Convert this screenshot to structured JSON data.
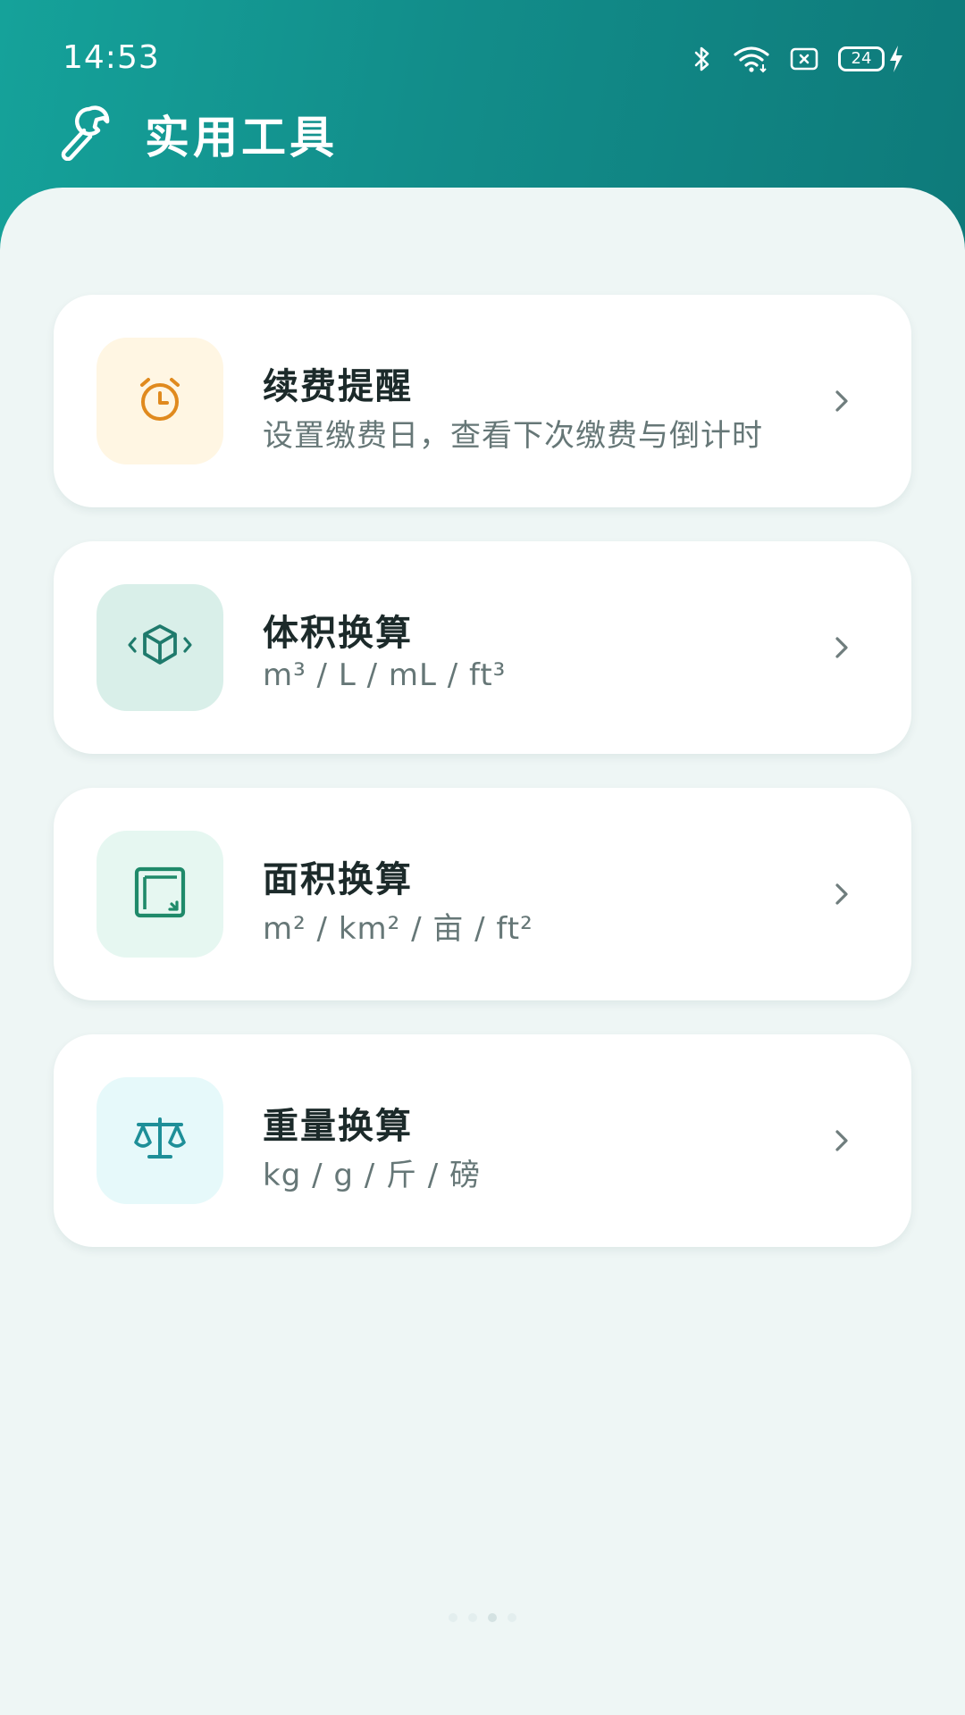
{
  "status_bar": {
    "time": "14:53",
    "battery": "24"
  },
  "header": {
    "title": "实用工具"
  },
  "tools": [
    {
      "title": "续费提醒",
      "subtitle": "设置缴费日，查看下次缴费与倒计时",
      "icon": "alarm-clock-icon",
      "color": "#e08a1e",
      "bg": "#fff6e3"
    },
    {
      "title": "体积换算",
      "subtitle": "m³ / L / mL / ft³",
      "icon": "cube-icon",
      "color": "#1f7a6c",
      "bg": "#d9efe9"
    },
    {
      "title": "面积换算",
      "subtitle": "m² / km² / 亩 / ft²",
      "icon": "area-square-icon",
      "color": "#1f8a6a",
      "bg": "#e6f7f1"
    },
    {
      "title": "重量换算",
      "subtitle": "kg / g / 斤 / 磅",
      "icon": "scale-icon",
      "color": "#1e8f98",
      "bg": "#e6f9fa"
    }
  ]
}
